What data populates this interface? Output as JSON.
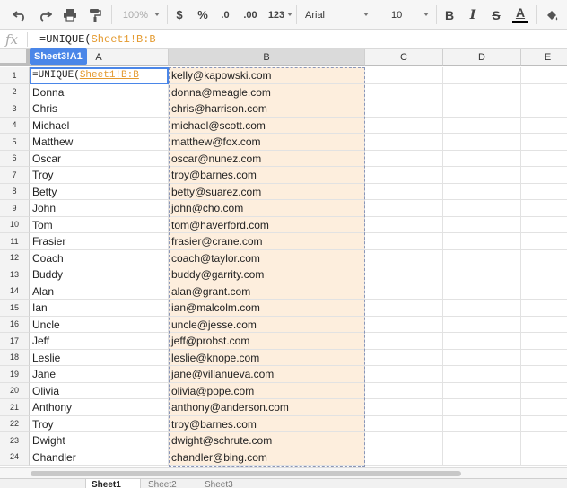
{
  "toolbar": {
    "icons": [
      "undo-icon",
      "redo-icon",
      "print-icon",
      "paint-format-icon"
    ],
    "zoom": "100%",
    "currency": "$",
    "percent": "%",
    "decrease_decimals": ".0",
    "increase_decimals": ".00",
    "more_formats": "123",
    "font": "Arial",
    "font_size": "10",
    "bold": "B",
    "italic": "I",
    "strikethrough": "S",
    "text_color": "A",
    "text_color_bar": "#000000"
  },
  "formula_bar": {
    "fx": "fx",
    "prefix": "=UNIQUE(",
    "range": "Sheet1!B:B"
  },
  "name_tag": "Sheet3!A1",
  "columns": [
    "A",
    "B",
    "C",
    "D",
    "E"
  ],
  "rows": [
    {
      "n": "1",
      "a": "",
      "b": "kelly@kapowski.com"
    },
    {
      "n": "2",
      "a": "Donna",
      "b": "donna@meagle.com"
    },
    {
      "n": "3",
      "a": "Chris",
      "b": "chris@harrison.com"
    },
    {
      "n": "4",
      "a": "Michael",
      "b": "michael@scott.com"
    },
    {
      "n": "5",
      "a": "Matthew",
      "b": "matthew@fox.com"
    },
    {
      "n": "6",
      "a": "Oscar",
      "b": "oscar@nunez.com"
    },
    {
      "n": "7",
      "a": "Troy",
      "b": "troy@barnes.com"
    },
    {
      "n": "8",
      "a": "Betty",
      "b": "betty@suarez.com"
    },
    {
      "n": "9",
      "a": "John",
      "b": "john@cho.com"
    },
    {
      "n": "10",
      "a": "Tom",
      "b": "tom@haverford.com"
    },
    {
      "n": "11",
      "a": "Frasier",
      "b": "frasier@crane.com"
    },
    {
      "n": "12",
      "a": "Coach",
      "b": "coach@taylor.com"
    },
    {
      "n": "13",
      "a": "Buddy",
      "b": "buddy@garrity.com"
    },
    {
      "n": "14",
      "a": "Alan",
      "b": "alan@grant.com"
    },
    {
      "n": "15",
      "a": "Ian",
      "b": "ian@malcolm.com"
    },
    {
      "n": "16",
      "a": "Uncle",
      "b": "uncle@jesse.com"
    },
    {
      "n": "17",
      "a": "Jeff",
      "b": "jeff@probst.com"
    },
    {
      "n": "18",
      "a": "Leslie",
      "b": "leslie@knope.com"
    },
    {
      "n": "19",
      "a": "Jane",
      "b": "jane@villanueva.com"
    },
    {
      "n": "20",
      "a": "Olivia",
      "b": "olivia@pope.com"
    },
    {
      "n": "21",
      "a": "Anthony",
      "b": "anthony@anderson.com"
    },
    {
      "n": "22",
      "a": "Troy",
      "b": "troy@barnes.com"
    },
    {
      "n": "23",
      "a": "Dwight",
      "b": "dwight@schrute.com"
    },
    {
      "n": "24",
      "a": "Chandler",
      "b": "chandler@bing.com"
    }
  ],
  "sheet_tabs": [
    "Sheet1",
    "Sheet2",
    "Sheet3"
  ],
  "colors": {
    "accent": "#4a86e8",
    "range_highlight": "#fdeedd",
    "range_ref": "#e49a2f"
  }
}
